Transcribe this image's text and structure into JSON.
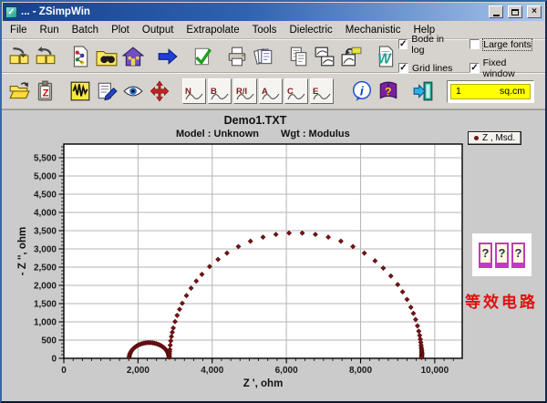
{
  "window": {
    "title": "... - ZSimpWin"
  },
  "menu": {
    "items": [
      "File",
      "Run",
      "Batch",
      "Plot",
      "Output",
      "Extrapolate",
      "Tools",
      "Dielectric",
      "Mechanistic",
      "Help"
    ]
  },
  "toolbar_top": {
    "buttons": [
      {
        "name": "save-data",
        "icon": "folder-arrow-down"
      },
      {
        "name": "load-data",
        "icon": "folder-arrow-up"
      },
      {
        "name": "model-document",
        "icon": "molecule-doc",
        "gap": true
      },
      {
        "name": "find",
        "icon": "find-folder"
      },
      {
        "name": "home",
        "icon": "home"
      },
      {
        "name": "run-next",
        "icon": "arrow-right",
        "gap": true
      },
      {
        "name": "validate",
        "icon": "check-doc",
        "gap": true
      },
      {
        "name": "print",
        "icon": "printer",
        "gap": true
      },
      {
        "name": "print-preview",
        "icon": "print-pages"
      },
      {
        "name": "copy",
        "icon": "copy-pages",
        "gap": true
      },
      {
        "name": "copy-charts",
        "icon": "chart-windows"
      },
      {
        "name": "export-chart",
        "icon": "export-chart"
      },
      {
        "name": "export-word",
        "icon": "word-doc",
        "gap": true
      }
    ]
  },
  "options": {
    "bode_in_log": {
      "label": "Bode in log",
      "checked": true
    },
    "grid_lines": {
      "label": "Grid lines",
      "checked": true
    },
    "large_fonts": {
      "label": "Large fonts",
      "checked": false
    },
    "fixed_window": {
      "label": "Fixed window",
      "checked": true
    }
  },
  "toolbar_bottom": {
    "buttons": [
      {
        "name": "open-data-file",
        "icon": "open-folder"
      },
      {
        "name": "paste-impedance",
        "icon": "paste-z"
      },
      {
        "name": "signal",
        "icon": "waveform",
        "gap": true
      },
      {
        "name": "notes",
        "icon": "notepad-pen"
      },
      {
        "name": "view",
        "icon": "eye"
      },
      {
        "name": "pan",
        "icon": "move-arrows"
      }
    ],
    "plot_types": [
      {
        "label": "N",
        "name": "nyquist"
      },
      {
        "label": "B",
        "name": "bode"
      },
      {
        "label": "R/I",
        "name": "real-imag"
      },
      {
        "label": "A",
        "name": "admittance"
      },
      {
        "label": "C",
        "name": "capacitance"
      },
      {
        "label": "E",
        "name": "error"
      }
    ],
    "buttons2": [
      {
        "name": "info",
        "icon": "info",
        "gap": true
      },
      {
        "name": "help",
        "icon": "help-book"
      },
      {
        "name": "exit",
        "icon": "exit-door",
        "gap": true
      }
    ],
    "area_field": {
      "value": "1",
      "unit": "sq.cm"
    }
  },
  "side": {
    "legend": {
      "marker_color": "#7a1214",
      "label": "Z , Msd."
    },
    "equivalent_circuit": {
      "cards": [
        "?",
        "?",
        "?"
      ],
      "caption": "等效电路",
      "caption_color": "#e01010"
    }
  },
  "chart_data": {
    "type": "scatter",
    "title": "Demo1.TXT",
    "subtitle_model": "Model : Unknown",
    "subtitle_wgt": "Wgt : Modulus",
    "xlabel": "Z ', ohm",
    "ylabel": "- Z '', ohm",
    "xlim": [
      0,
      10740
    ],
    "ylim": [
      0,
      5875
    ],
    "x_tick_step": 2000,
    "x_minor_step": 250,
    "y_tick_step": 500,
    "y_minor_step": 100,
    "grid": true,
    "grid_color": "#b5b5b5",
    "legend_label": "Z , Msd.",
    "marker": "diamond",
    "marker_color": "#7a1214",
    "series": [
      {
        "name": "Z , Msd.",
        "points": [
          [
            1762,
            37
          ],
          [
            1768,
            75
          ],
          [
            1778,
            111
          ],
          [
            1792,
            147
          ],
          [
            1811,
            182
          ],
          [
            1832,
            215
          ],
          [
            1858,
            247
          ],
          [
            1886,
            276
          ],
          [
            1918,
            304
          ],
          [
            1953,
            329
          ],
          [
            1990,
            352
          ],
          [
            2030,
            372
          ],
          [
            2072,
            390
          ],
          [
            2115,
            404
          ],
          [
            2160,
            415
          ],
          [
            2206,
            424
          ],
          [
            2253,
            428
          ],
          [
            2300,
            430
          ],
          [
            2347,
            428
          ],
          [
            2394,
            424
          ],
          [
            2440,
            415
          ],
          [
            2485,
            404
          ],
          [
            2528,
            390
          ],
          [
            2570,
            372
          ],
          [
            2610,
            352
          ],
          [
            2647,
            329
          ],
          [
            2682,
            304
          ],
          [
            2714,
            276
          ],
          [
            2742,
            247
          ],
          [
            2768,
            215
          ],
          [
            2785,
            188
          ],
          [
            2801,
            161
          ],
          [
            2814,
            133
          ],
          [
            2822,
            111
          ],
          [
            2828,
            89
          ],
          [
            2833,
            67
          ],
          [
            2837,
            49
          ],
          [
            2839,
            30
          ],
          [
            2845,
            60
          ],
          [
            2850,
            120
          ],
          [
            2854,
            180
          ],
          [
            2858,
            240
          ],
          [
            2869,
            360
          ],
          [
            2883,
            479
          ],
          [
            2901,
            597
          ],
          [
            2924,
            715
          ],
          [
            2951,
            832
          ],
          [
            2998,
            1006
          ],
          [
            3055,
            1177
          ],
          [
            3120,
            1344
          ],
          [
            3194,
            1508
          ],
          [
            3306,
            1720
          ],
          [
            3431,
            1924
          ],
          [
            3571,
            2118
          ],
          [
            3723,
            2302
          ],
          [
            3931,
            2516
          ],
          [
            4157,
            2711
          ],
          [
            4398,
            2885
          ],
          [
            4706,
            3065
          ],
          [
            5031,
            3212
          ],
          [
            5370,
            3323
          ],
          [
            5718,
            3398
          ],
          [
            6072,
            3435
          ],
          [
            6428,
            3435
          ],
          [
            6782,
            3398
          ],
          [
            7130,
            3323
          ],
          [
            7469,
            3212
          ],
          [
            7794,
            3065
          ],
          [
            8102,
            2885
          ],
          [
            8390,
            2673
          ],
          [
            8612,
            2474
          ],
          [
            8816,
            2257
          ],
          [
            9001,
            2022
          ],
          [
            9133,
            1823
          ],
          [
            9252,
            1615
          ],
          [
            9356,
            1399
          ],
          [
            9424,
            1233
          ],
          [
            9484,
            1063
          ],
          [
            9534,
            890
          ],
          [
            9569,
            744
          ],
          [
            9593,
            627
          ],
          [
            9610,
            526
          ],
          [
            9622,
            437
          ],
          [
            9631,
            360
          ],
          [
            9637,
            300
          ],
          [
            9641,
            252
          ],
          [
            9652,
            210
          ],
          [
            9643,
            174
          ],
          [
            9658,
            144
          ],
          [
            9646,
            120
          ],
          [
            9655,
            96
          ],
          [
            9642,
            72
          ],
          [
            9653,
            48
          ],
          [
            9647,
            24
          ]
        ]
      }
    ]
  }
}
